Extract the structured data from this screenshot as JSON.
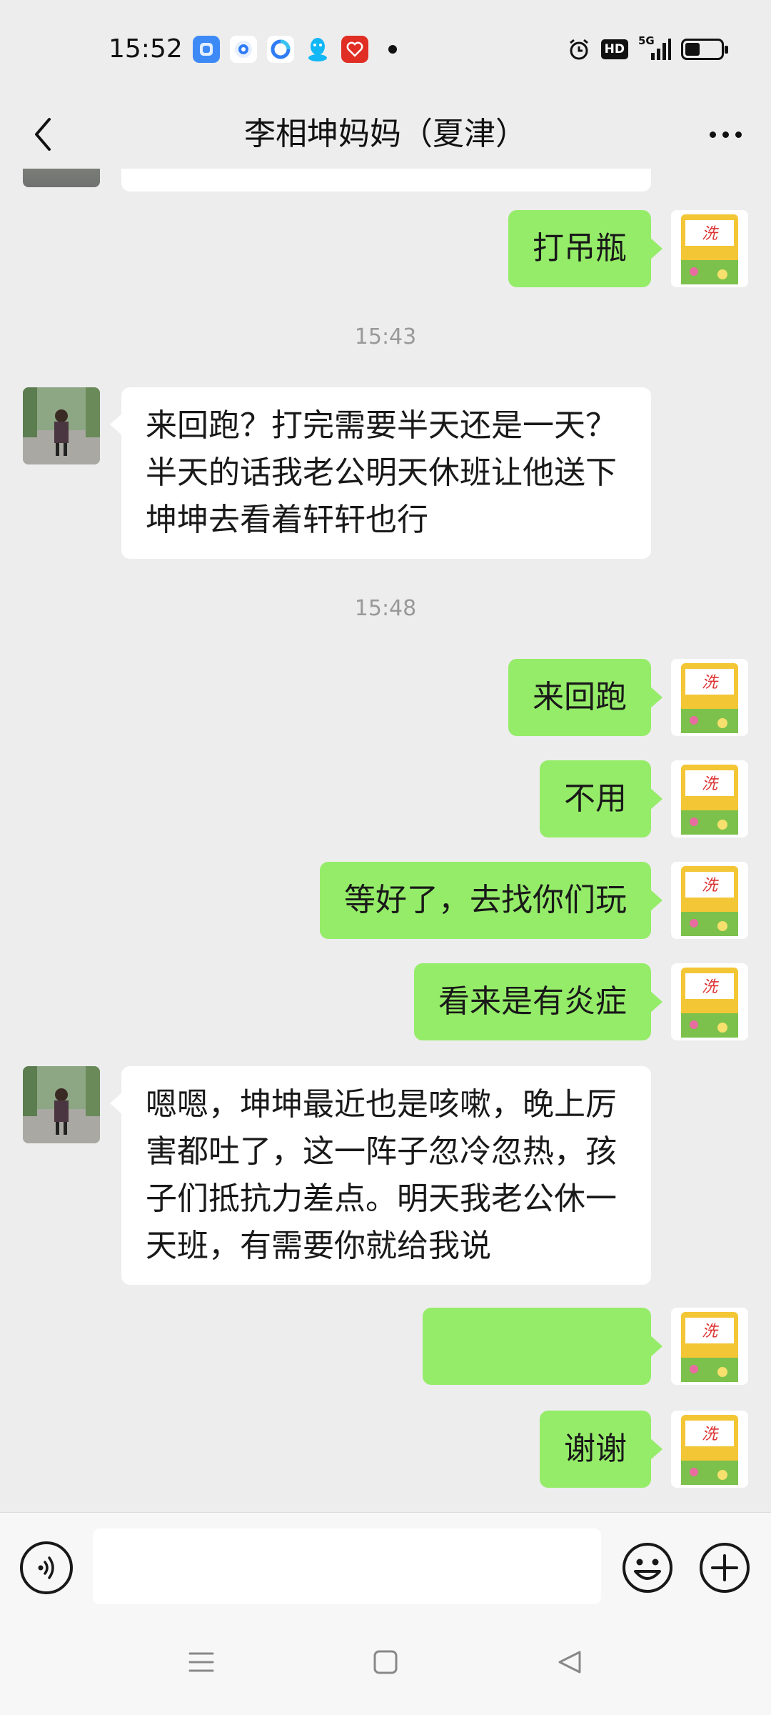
{
  "status_bar": {
    "time": "15:52",
    "hd_label": "HD",
    "network_label": "5G",
    "app_icons": [
      "app-icon",
      "location-icon",
      "browser-icon",
      "qq-icon",
      "heart-app-icon"
    ]
  },
  "header": {
    "title": "李相坤妈妈（夏津）",
    "back_icon": "back-chevron-icon",
    "more_icon": "more-dots-icon"
  },
  "messages": [
    {
      "side": "right",
      "text": "打吊瓶"
    },
    {
      "type": "timestamp",
      "text": "15:43"
    },
    {
      "side": "left",
      "text": "来回跑？打完需要半天还是一天？半天的话我老公明天休班让他送下坤坤去看着轩轩也行"
    },
    {
      "type": "timestamp",
      "text": "15:48"
    },
    {
      "side": "right",
      "text": "来回跑"
    },
    {
      "side": "right",
      "text": "不用"
    },
    {
      "side": "right",
      "text": "等好了，去找你们玩"
    },
    {
      "side": "right",
      "text": "看来是有炎症"
    },
    {
      "side": "left",
      "text": "嗯嗯，坤坤最近也是咳嗽，晚上厉害都吐了，这一阵子忽冷忽热，孩子们抵抗力差点。明天我老公休一天班，有需要你就给我说"
    },
    {
      "side": "right",
      "text": "",
      "emojis": [
        "smile-emoji",
        "smile-emoji"
      ]
    },
    {
      "side": "right",
      "text": "谢谢"
    }
  ],
  "input_bar": {
    "voice_icon": "voice-icon",
    "emoji_icon": "emoji-icon",
    "plus_icon": "plus-icon",
    "input_value": ""
  },
  "nav_bar": {
    "icons": [
      "menu-icon",
      "home-icon",
      "back-icon"
    ]
  },
  "colors": {
    "background": "#ededed",
    "sent_bubble": "#95ec69",
    "received_bubble": "#ffffff",
    "timestamp": "#999999"
  }
}
